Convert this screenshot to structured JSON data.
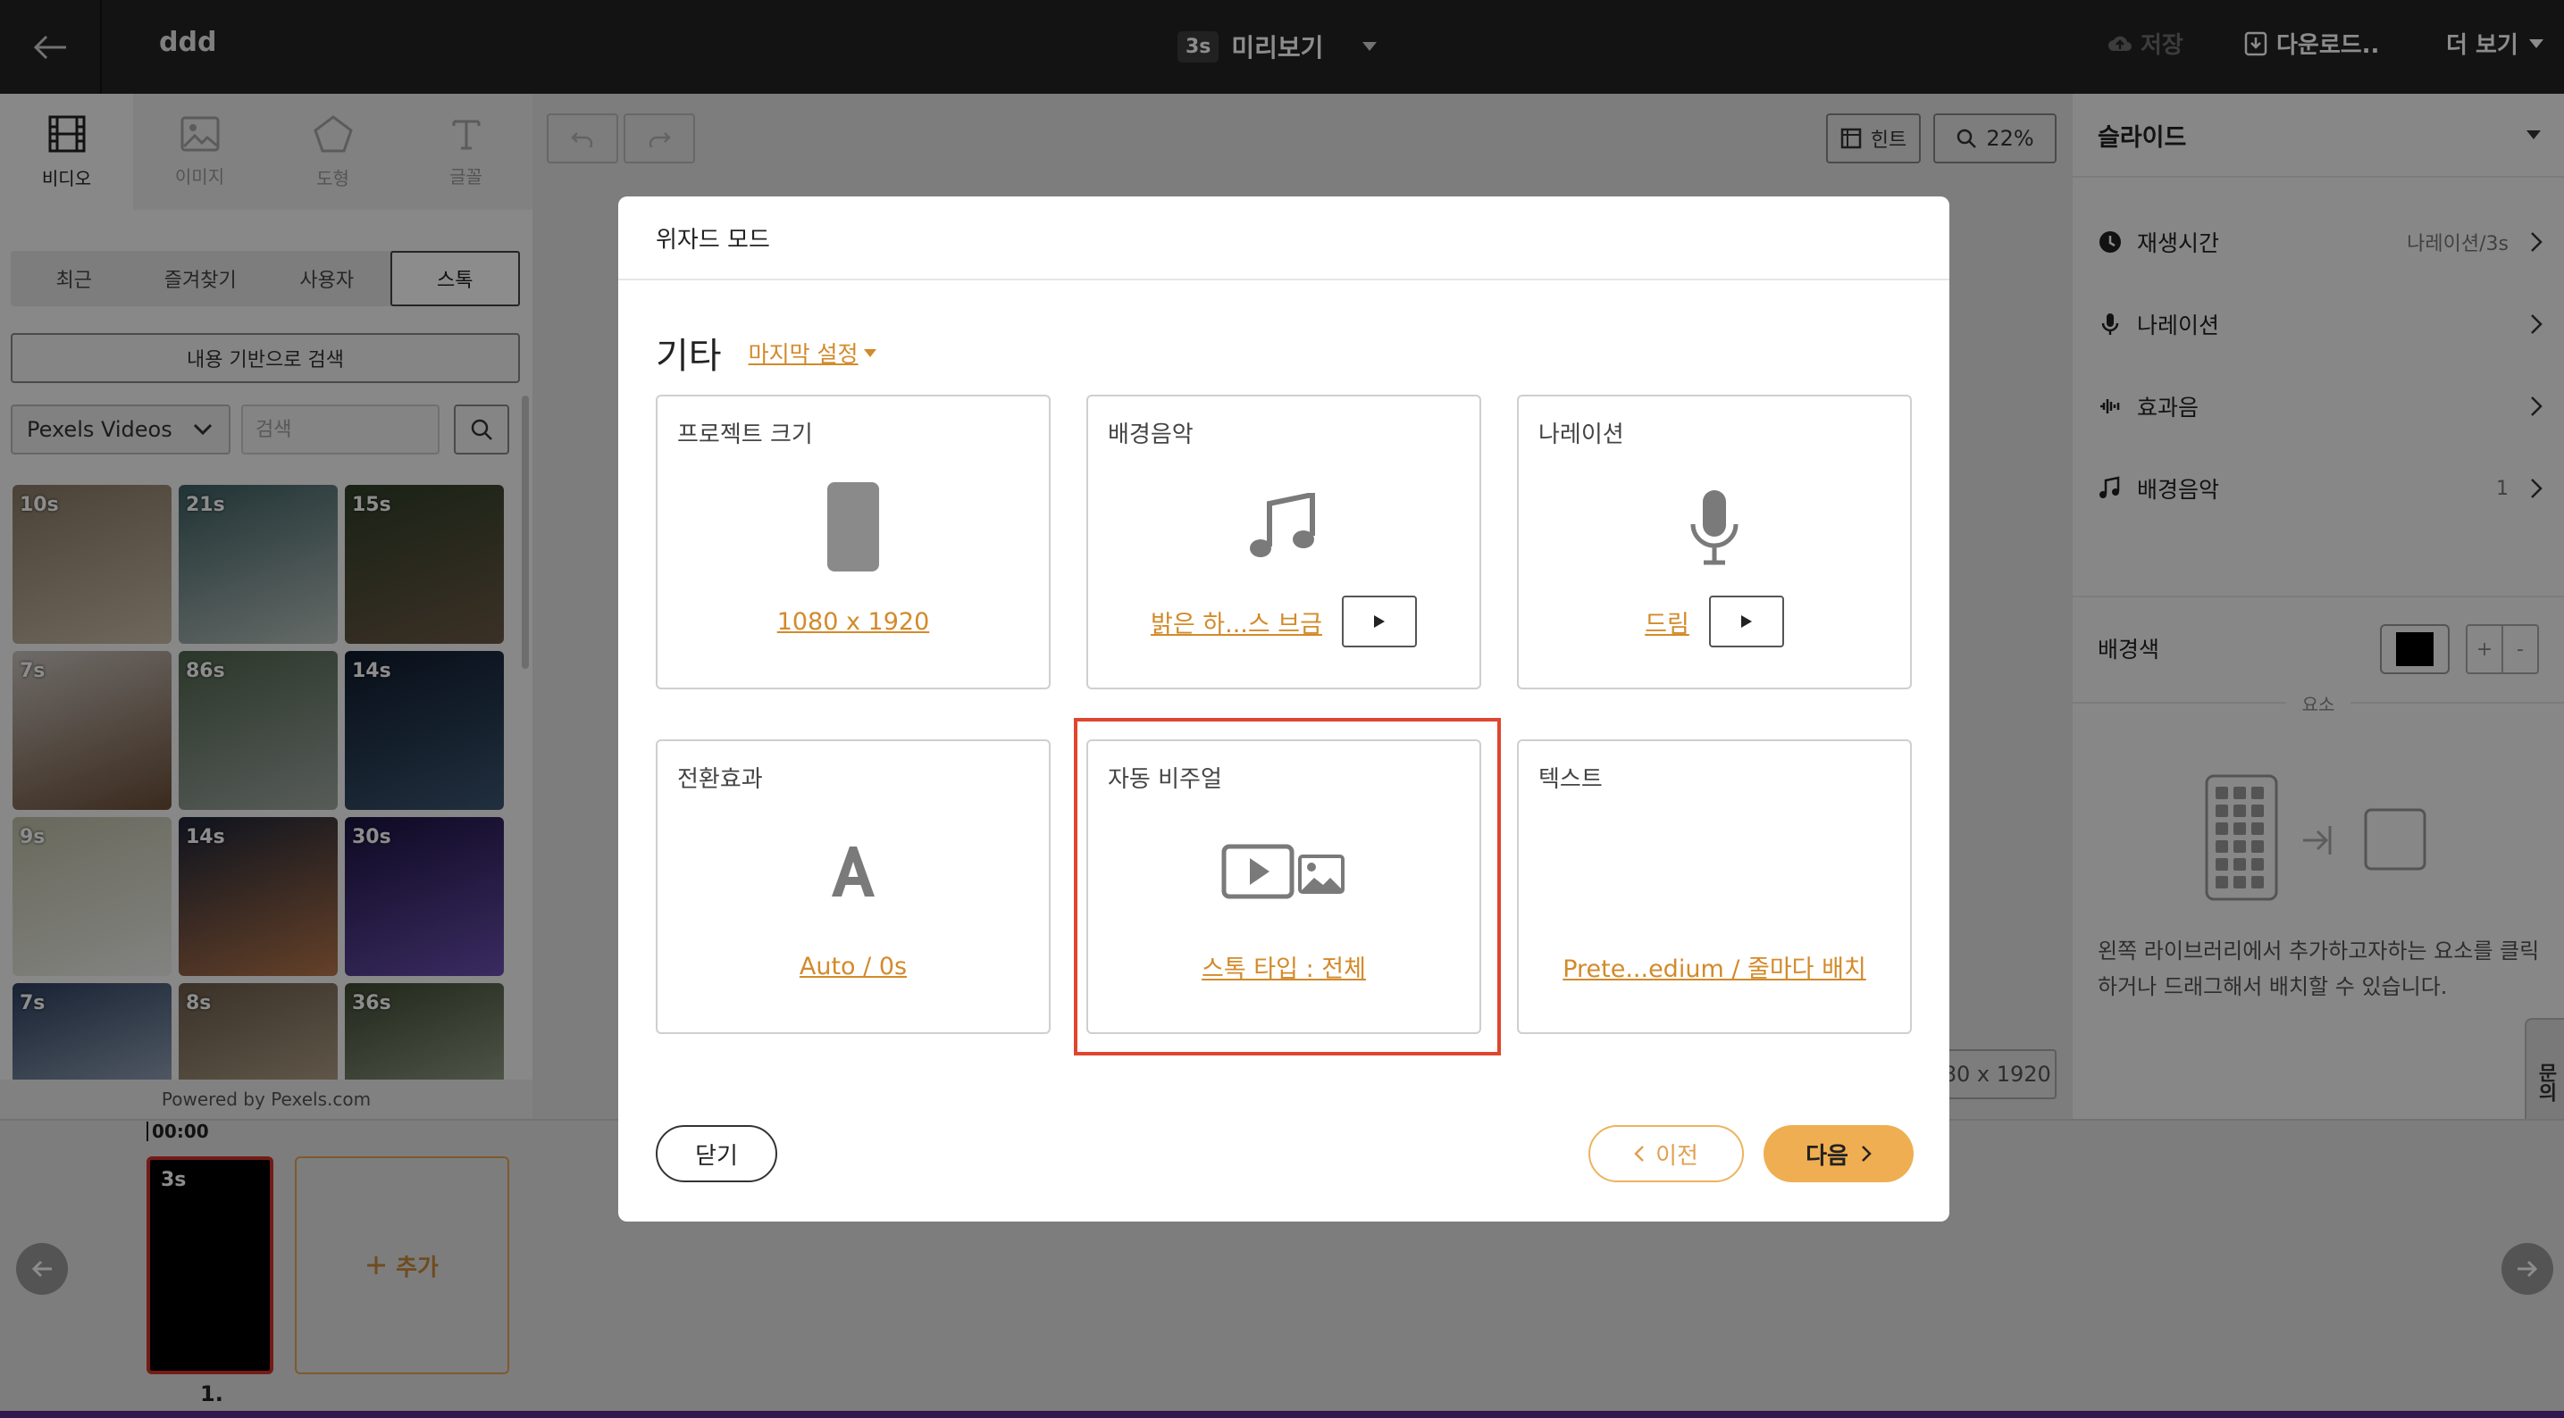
{
  "topbar": {
    "back_icon": "arrow-left-icon",
    "project_title": "ddd",
    "duration_badge": "3s",
    "preview_label": "미리보기",
    "save_label": "저장",
    "download_label": "다운로드..",
    "more_label": "더 보기"
  },
  "left_panel": {
    "tabs": [
      {
        "label": "비디오",
        "icon": "film-icon",
        "active": true
      },
      {
        "label": "이미지",
        "icon": "image-icon",
        "active": false
      },
      {
        "label": "도형",
        "icon": "pentagon-icon",
        "active": false
      },
      {
        "label": "글꼴",
        "icon": "text-icon",
        "active": false
      }
    ],
    "subtabs": [
      "최근",
      "즐겨찾기",
      "사용자",
      "스톡"
    ],
    "active_subtab": "스톡",
    "content_search_label": "내용 기반으로 검색",
    "source_select": "Pexels Videos",
    "search_placeholder": "검색",
    "thumbnails": [
      {
        "duration": "10s",
        "color_a": "#8a7a66",
        "color_b": "#c9bca6"
      },
      {
        "duration": "21s",
        "color_a": "#3d5e62",
        "color_b": "#b8c2bd"
      },
      {
        "duration": "15s",
        "color_a": "#2f3f28",
        "color_b": "#6c5846"
      },
      {
        "duration": "7s",
        "color_a": "#c9c3be",
        "color_b": "#6b4e37"
      },
      {
        "duration": "86s",
        "color_a": "#50654e",
        "color_b": "#9fa7a2"
      },
      {
        "duration": "14s",
        "color_a": "#0e1a2c",
        "color_b": "#3c5672"
      },
      {
        "duration": "9s",
        "color_a": "#bfc0a8",
        "color_b": "#eeeeea"
      },
      {
        "duration": "14s",
        "color_a": "#1b2437",
        "color_b": "#b8764a"
      },
      {
        "duration": "30s",
        "color_a": "#1a1240",
        "color_b": "#6b4fb0"
      },
      {
        "duration": "7s",
        "color_a": "#2d3f5e",
        "color_b": "#b7c5d6"
      },
      {
        "duration": "8s",
        "color_a": "#6b5a4a",
        "color_b": "#c8b89c"
      },
      {
        "duration": "36s",
        "color_a": "#3d4a32",
        "color_b": "#aeb8a0"
      }
    ],
    "credit": "Powered by Pexels.com"
  },
  "canvas": {
    "hint_label": "힌트",
    "zoom_level": "22%",
    "canvas_size": "1080 x 1920"
  },
  "right_panel": {
    "section_title": "슬라이드",
    "rows": [
      {
        "icon": "clock-icon",
        "label": "재생시간",
        "value": "나레이션/3s"
      },
      {
        "icon": "microphone-icon",
        "label": "나레이션",
        "value": ""
      },
      {
        "icon": "sound-wave-icon",
        "label": "효과음",
        "value": ""
      },
      {
        "icon": "music-note-icon",
        "label": "배경음악",
        "value": "1"
      }
    ],
    "bg_color_label": "배경색",
    "bg_color": "#000000",
    "plus": "+",
    "minus": "-",
    "elements_label": "요소",
    "elements_help": "왼쪽 라이브러리에서 추가하고자하는 요소를 클릭하거나 드래그해서 배치할 수 있습니다.",
    "inquiry_label": "문의"
  },
  "timeline": {
    "time_marker": "00:00",
    "clip_duration": "3s",
    "clip_number": "1.",
    "add_label": "추가"
  },
  "modal": {
    "title": "위자드 모드",
    "section": "기타",
    "last_settings": "마지막 설정",
    "cards": [
      {
        "title": "프로젝트 크기",
        "icon": "phone-portrait-icon",
        "link": "1080 x 1920",
        "has_play": false
      },
      {
        "title": "배경음악",
        "icon": "music-note-icon",
        "link": "밝은 하...스 브금",
        "has_play": true
      },
      {
        "title": "나레이션",
        "icon": "microphone-icon",
        "link": "드림",
        "has_play": true
      },
      {
        "title": "전환효과",
        "icon": "letter-a-icon",
        "link": "Auto / 0s",
        "has_play": false
      },
      {
        "title": "자동 비주얼",
        "icon": "video-image-icon",
        "link": "스톡 타입 : 전체",
        "has_play": false,
        "highlighted": true
      },
      {
        "title": "텍스트",
        "icon": "",
        "link": "Prete...edium / 줄마다 배치",
        "has_play": false
      }
    ],
    "close_label": "닫기",
    "prev_label": "이전",
    "next_label": "다음"
  },
  "colors": {
    "accent": "#efae51",
    "accent_text": "#d38a2a",
    "highlight_border": "#e0452f",
    "topbar_bg": "#232323"
  }
}
